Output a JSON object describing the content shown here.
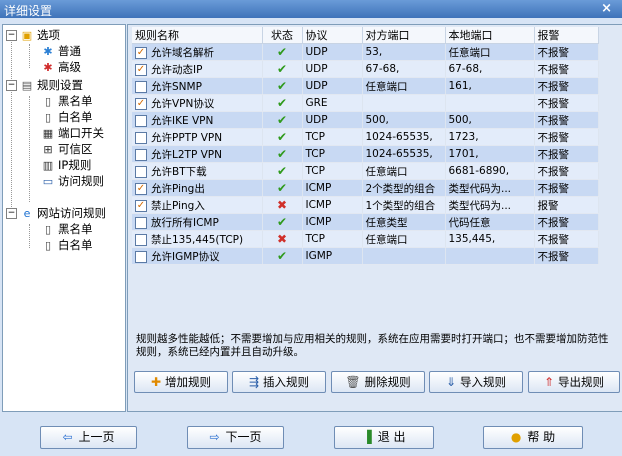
{
  "window": {
    "title": "详细设置",
    "close": "×"
  },
  "tree": {
    "options": "选项",
    "normal": "普通",
    "advanced": "高级",
    "rules": "规则设置",
    "blacklist": "黑名单",
    "whitelist": "白名单",
    "port_switch": "端口开关",
    "trusted": "可信区",
    "ip_rules": "IP规则",
    "access_rules": "访问规则",
    "site_rules": "网站访问规则",
    "site_blacklist": "黑名单",
    "site_whitelist": "白名单",
    "collapse": "−"
  },
  "table": {
    "headers": [
      "规则名称",
      "状态",
      "协议",
      "对方端口",
      "本地端口",
      "报警"
    ],
    "rows": [
      {
        "checked": true,
        "name": "允许域名解析",
        "status": "ok",
        "protocol": "UDP",
        "remote": "53,",
        "local": "任意端口",
        "alarm": "不报警"
      },
      {
        "checked": true,
        "name": "允许动态IP",
        "status": "ok",
        "protocol": "UDP",
        "remote": "67-68,",
        "local": "67-68,",
        "alarm": "不报警"
      },
      {
        "checked": false,
        "name": "允许SNMP",
        "status": "ok",
        "protocol": "UDP",
        "remote": "任意端口",
        "local": "161,",
        "alarm": "不报警"
      },
      {
        "checked": true,
        "name": "允许VPN协议",
        "status": "ok",
        "protocol": "GRE",
        "remote": "",
        "local": "",
        "alarm": "不报警"
      },
      {
        "checked": false,
        "name": "允许IKE VPN",
        "status": "ok",
        "protocol": "UDP",
        "remote": "500,",
        "local": "500,",
        "alarm": "不报警"
      },
      {
        "checked": false,
        "name": "允许PPTP VPN",
        "status": "ok",
        "protocol": "TCP",
        "remote": "1024-65535,",
        "local": "1723,",
        "alarm": "不报警"
      },
      {
        "checked": false,
        "name": "允许L2TP VPN",
        "status": "ok",
        "protocol": "TCP",
        "remote": "1024-65535,",
        "local": "1701,",
        "alarm": "不报警"
      },
      {
        "checked": false,
        "name": "允许BT下载",
        "status": "ok",
        "protocol": "TCP",
        "remote": "任意端口",
        "local": "6681-6890,",
        "alarm": "不报警"
      },
      {
        "checked": true,
        "name": "允许Ping出",
        "status": "ok",
        "protocol": "ICMP",
        "remote": "2个类型的组合",
        "local": "类型代码为...",
        "alarm": "不报警"
      },
      {
        "checked": true,
        "name": "禁止Ping入",
        "status": "x",
        "protocol": "ICMP",
        "remote": "1个类型的组合",
        "local": "类型代码为...",
        "alarm": "报警"
      },
      {
        "checked": false,
        "name": "放行所有ICMP",
        "status": "ok",
        "protocol": "ICMP",
        "remote": "任意类型",
        "local": "代码任意",
        "alarm": "不报警"
      },
      {
        "checked": false,
        "name": "禁止135,445(TCP)",
        "status": "x",
        "protocol": "TCP",
        "remote": "任意端口",
        "local": "135,445,",
        "alarm": "不报警"
      },
      {
        "checked": false,
        "name": "允许IGMP协议",
        "status": "ok",
        "protocol": "IGMP",
        "remote": "",
        "local": "",
        "alarm": "不报警"
      }
    ]
  },
  "note": "规则越多性能越低；不需要增加与应用相关的规则，系统在应用需要时打开端口；也不需要增加防范性规则，系统已经内置并且自动升级。",
  "buttons": {
    "add": "增加规则",
    "insert": "插入规则",
    "delete": "删除规则",
    "import": "导入规则",
    "export": "导出规则"
  },
  "nav": {
    "prev": "上一页",
    "next": "下一页",
    "exit": "退 出",
    "help": "帮 助"
  },
  "colors": {
    "accent": "#3e73b9",
    "ok": "#2f9a1c",
    "deny": "#d0302a"
  }
}
